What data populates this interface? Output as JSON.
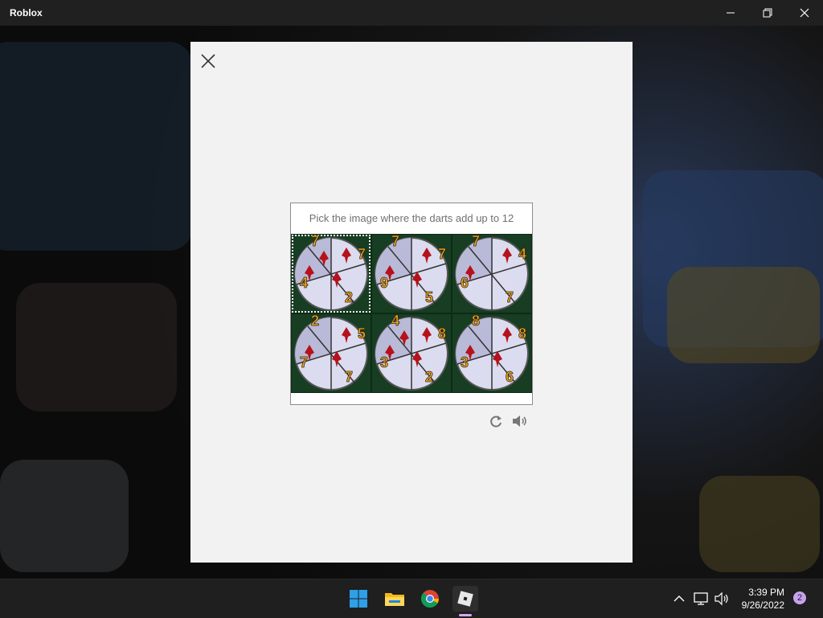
{
  "window": {
    "title": "Roblox"
  },
  "dialog": {
    "close_icon": "close-icon"
  },
  "captcha": {
    "prompt": "Pick the image where the darts add up to 12",
    "tiles": [
      {
        "numbers": [
          "7",
          "7",
          "4",
          "2"
        ],
        "darts": 4,
        "selected": true
      },
      {
        "numbers": [
          "7",
          "7",
          "9",
          "5"
        ],
        "darts": 3,
        "selected": false
      },
      {
        "numbers": [
          "7",
          "4",
          "6",
          "7"
        ],
        "darts": 2,
        "selected": false
      },
      {
        "numbers": [
          "2",
          "5",
          "7",
          "7"
        ],
        "darts": 3,
        "selected": false
      },
      {
        "numbers": [
          "4",
          "8",
          "3",
          "2"
        ],
        "darts": 4,
        "selected": false
      },
      {
        "numbers": [
          "8",
          "8",
          "3",
          "6"
        ],
        "darts": 3,
        "selected": false
      }
    ],
    "refresh_icon": "refresh-icon",
    "audio_icon": "speaker-icon"
  },
  "taskbar": {
    "apps": [
      "windows-start-icon",
      "file-explorer-icon",
      "chrome-icon",
      "roblox-icon"
    ],
    "time": "3:39 PM",
    "date": "9/26/2022",
    "notification_count": "2"
  },
  "colors": {
    "accent": "#d9a3ff",
    "tile_green": "#173d22",
    "dart_red": "#b5121b",
    "number_gold": "#f0a928"
  }
}
